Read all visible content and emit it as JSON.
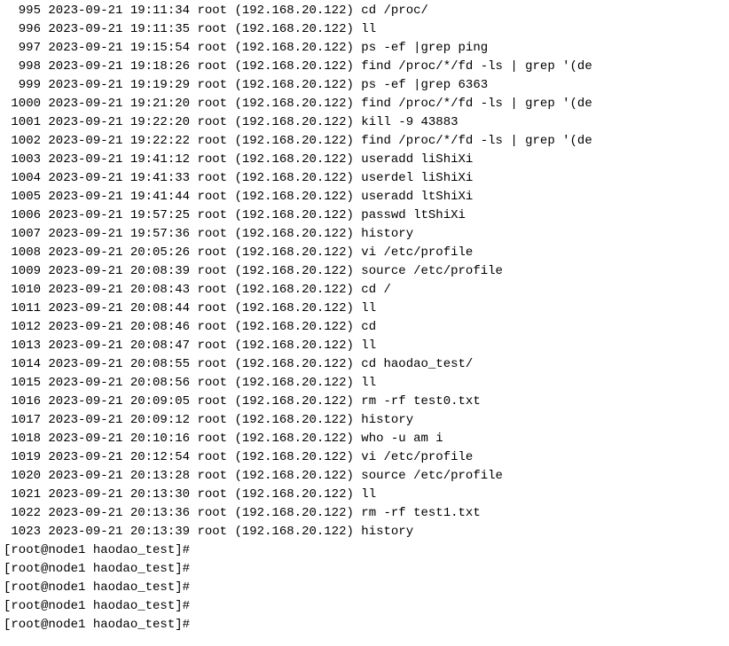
{
  "history": [
    {
      "n": "995",
      "dt": "2023-09-21 19:11:34",
      "user": "root",
      "ip": "(192.168.20.122)",
      "cmd": "cd /proc/"
    },
    {
      "n": "996",
      "dt": "2023-09-21 19:11:35",
      "user": "root",
      "ip": "(192.168.20.122)",
      "cmd": "ll"
    },
    {
      "n": "997",
      "dt": "2023-09-21 19:15:54",
      "user": "root",
      "ip": "(192.168.20.122)",
      "cmd": "ps -ef |grep ping"
    },
    {
      "n": "998",
      "dt": "2023-09-21 19:18:26",
      "user": "root",
      "ip": "(192.168.20.122)",
      "cmd": "find /proc/*/fd -ls | grep  '(de"
    },
    {
      "n": "999",
      "dt": "2023-09-21 19:19:29",
      "user": "root",
      "ip": "(192.168.20.122)",
      "cmd": "ps -ef |grep 6363"
    },
    {
      "n": "1000",
      "dt": "2023-09-21 19:21:20",
      "user": "root",
      "ip": "(192.168.20.122)",
      "cmd": "find /proc/*/fd -ls | grep  '(de"
    },
    {
      "n": "1001",
      "dt": "2023-09-21 19:22:20",
      "user": "root",
      "ip": "(192.168.20.122)",
      "cmd": "kill -9 43883"
    },
    {
      "n": "1002",
      "dt": "2023-09-21 19:22:22",
      "user": "root",
      "ip": "(192.168.20.122)",
      "cmd": "find /proc/*/fd -ls | grep  '(de"
    },
    {
      "n": "1003",
      "dt": "2023-09-21 19:41:12",
      "user": "root",
      "ip": "(192.168.20.122)",
      "cmd": "useradd liShiXi"
    },
    {
      "n": "1004",
      "dt": "2023-09-21 19:41:33",
      "user": "root",
      "ip": "(192.168.20.122)",
      "cmd": "userdel liShiXi"
    },
    {
      "n": "1005",
      "dt": "2023-09-21 19:41:44",
      "user": "root",
      "ip": "(192.168.20.122)",
      "cmd": "useradd ltShiXi"
    },
    {
      "n": "1006",
      "dt": "2023-09-21 19:57:25",
      "user": "root",
      "ip": "(192.168.20.122)",
      "cmd": "passwd ltShiXi"
    },
    {
      "n": "1007",
      "dt": "2023-09-21 19:57:36",
      "user": "root",
      "ip": "(192.168.20.122)",
      "cmd": "history"
    },
    {
      "n": "1008",
      "dt": "2023-09-21 20:05:26",
      "user": "root",
      "ip": "(192.168.20.122)",
      "cmd": "vi /etc/profile"
    },
    {
      "n": "1009",
      "dt": "2023-09-21 20:08:39",
      "user": "root",
      "ip": "(192.168.20.122)",
      "cmd": "source /etc/profile"
    },
    {
      "n": "1010",
      "dt": "2023-09-21 20:08:43",
      "user": "root",
      "ip": "(192.168.20.122)",
      "cmd": "cd /"
    },
    {
      "n": "1011",
      "dt": "2023-09-21 20:08:44",
      "user": "root",
      "ip": "(192.168.20.122)",
      "cmd": "ll"
    },
    {
      "n": "1012",
      "dt": "2023-09-21 20:08:46",
      "user": "root",
      "ip": "(192.168.20.122)",
      "cmd": "cd"
    },
    {
      "n": "1013",
      "dt": "2023-09-21 20:08:47",
      "user": "root",
      "ip": "(192.168.20.122)",
      "cmd": "ll"
    },
    {
      "n": "1014",
      "dt": "2023-09-21 20:08:55",
      "user": "root",
      "ip": "(192.168.20.122)",
      "cmd": "cd haodao_test/"
    },
    {
      "n": "1015",
      "dt": "2023-09-21 20:08:56",
      "user": "root",
      "ip": "(192.168.20.122)",
      "cmd": "ll"
    },
    {
      "n": "1016",
      "dt": "2023-09-21 20:09:05",
      "user": "root",
      "ip": "(192.168.20.122)",
      "cmd": "rm -rf test0.txt"
    },
    {
      "n": "1017",
      "dt": "2023-09-21 20:09:12",
      "user": "root",
      "ip": "(192.168.20.122)",
      "cmd": "history"
    },
    {
      "n": "1018",
      "dt": "2023-09-21 20:10:16",
      "user": "root",
      "ip": "(192.168.20.122)",
      "cmd": "who -u am i"
    },
    {
      "n": "1019",
      "dt": "2023-09-21 20:12:54",
      "user": "root",
      "ip": "(192.168.20.122)",
      "cmd": "vi /etc/profile"
    },
    {
      "n": "1020",
      "dt": "2023-09-21 20:13:28",
      "user": "root",
      "ip": "(192.168.20.122)",
      "cmd": "source /etc/profile"
    },
    {
      "n": "1021",
      "dt": "2023-09-21 20:13:30",
      "user": "root",
      "ip": "(192.168.20.122)",
      "cmd": "ll"
    },
    {
      "n": "1022",
      "dt": "2023-09-21 20:13:36",
      "user": "root",
      "ip": "(192.168.20.122)",
      "cmd": "rm -rf test1.txt"
    },
    {
      "n": "1023",
      "dt": "2023-09-21 20:13:39",
      "user": "root",
      "ip": "(192.168.20.122)",
      "cmd": "history"
    }
  ],
  "prompts": [
    "[root@node1 haodao_test]# ",
    "[root@node1 haodao_test]# ",
    "[root@node1 haodao_test]# ",
    "[root@node1 haodao_test]# ",
    "[root@node1 haodao_test]# "
  ]
}
